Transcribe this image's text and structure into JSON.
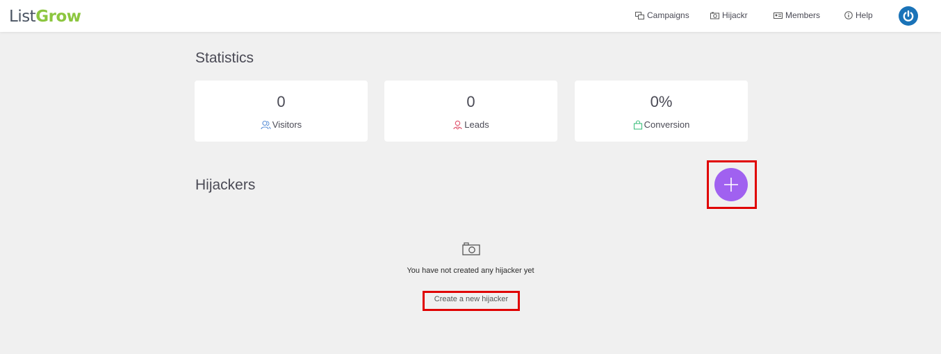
{
  "header": {
    "logo_part1": "List",
    "logo_part2": "Grow",
    "nav": {
      "campaigns": "Campaigns",
      "hijackr": "Hijackr",
      "members": "Members",
      "help": "Help"
    }
  },
  "statistics": {
    "title": "Statistics",
    "cards": [
      {
        "value": "0",
        "label": "Visitors",
        "icon": "visitors-icon",
        "color": "#5b8fd6"
      },
      {
        "value": "0",
        "label": "Leads",
        "icon": "leads-icon",
        "color": "#e0506a"
      },
      {
        "value": "0%",
        "label": "Conversion",
        "icon": "bag-icon",
        "color": "#3fbf7f"
      }
    ]
  },
  "hijackers": {
    "title": "Hijackers",
    "empty_message": "You have not created any hijacker yet",
    "create_link": "Create a new hijacker"
  },
  "colors": {
    "accent_purple": "#a061f0",
    "brand_green": "#8cc63f",
    "power_blue": "#1a73b8",
    "highlight_red": "#e00000"
  }
}
